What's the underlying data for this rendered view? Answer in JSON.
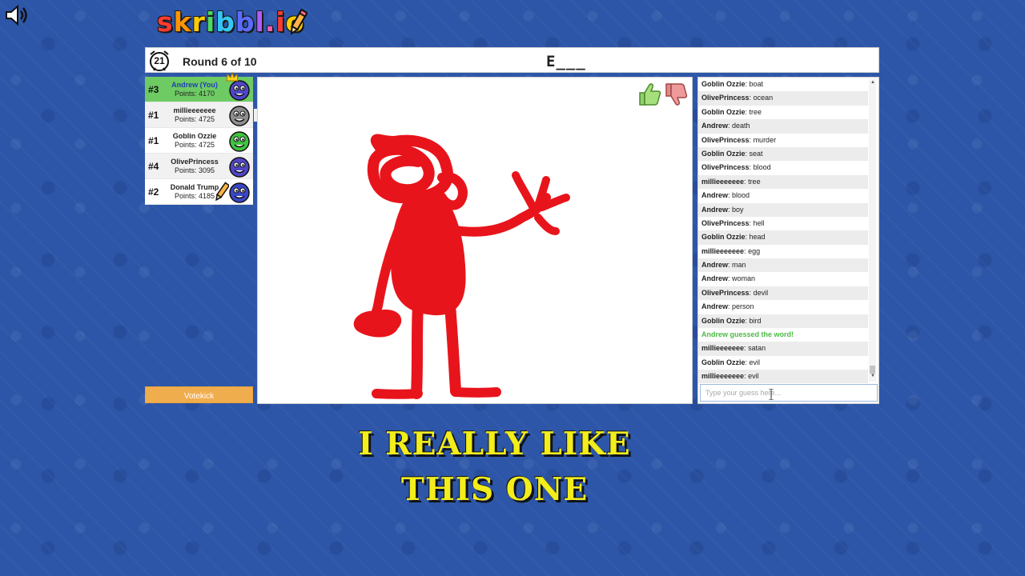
{
  "logo": {
    "letters": [
      "s",
      "k",
      "r",
      "i",
      "b",
      "b",
      "l",
      ".",
      "i",
      "o"
    ],
    "colors": [
      "#ff3b30",
      "#ff9500",
      "#ffcc00",
      "#4cd964",
      "#34c7f2",
      "#5a6cff",
      "#b15cff",
      "#ff5db1",
      "#ff3b30",
      "#ffcc00"
    ]
  },
  "header": {
    "timer": "21",
    "round": "Round 6 of 10",
    "word_hint": "E___"
  },
  "players": [
    {
      "rank": "#3",
      "name": "Andrew (You)",
      "points": "Points: 4170",
      "avatar_color": "#4f46c8",
      "me": true,
      "crown": true,
      "drawing": false
    },
    {
      "rank": "#1",
      "name": "millieeeeeee",
      "points": "Points: 4725",
      "avatar_color": "#8e8e8e",
      "me": false,
      "crown": false,
      "drawing": false
    },
    {
      "rank": "#1",
      "name": "Goblin Ozzie",
      "points": "Points: 4725",
      "avatar_color": "#3ec43e",
      "me": false,
      "crown": false,
      "drawing": false
    },
    {
      "rank": "#4",
      "name": "OlivePrincess",
      "points": "Points: 3095",
      "avatar_color": "#4f46c8",
      "me": false,
      "crown": false,
      "drawing": false
    },
    {
      "rank": "#2",
      "name": "Donald Trump",
      "points": "Points: 4185",
      "avatar_color": "#3a46c8",
      "me": false,
      "crown": false,
      "drawing": true
    }
  ],
  "guess_tip": "evil",
  "votekick_label": "Votekick",
  "chat": {
    "messages": [
      {
        "user": "Goblin Ozzie",
        "text": "boat"
      },
      {
        "user": "OlivePrincess",
        "text": "ocean"
      },
      {
        "user": "Goblin Ozzie",
        "text": "tree"
      },
      {
        "user": "Andrew",
        "text": "death"
      },
      {
        "user": "OlivePrincess",
        "text": "murder"
      },
      {
        "user": "Goblin Ozzie",
        "text": "seat"
      },
      {
        "user": "OlivePrincess",
        "text": "blood"
      },
      {
        "user": "millieeeeeee",
        "text": "tree"
      },
      {
        "user": "Andrew",
        "text": "blood"
      },
      {
        "user": "Andrew",
        "text": "boy"
      },
      {
        "user": "OlivePrincess",
        "text": "hell"
      },
      {
        "user": "Goblin Ozzie",
        "text": "head"
      },
      {
        "user": "millieeeeeee",
        "text": "egg"
      },
      {
        "user": "Andrew",
        "text": "man"
      },
      {
        "user": "Andrew",
        "text": "woman"
      },
      {
        "user": "OlivePrincess",
        "text": "devil"
      },
      {
        "user": "Andrew",
        "text": "person"
      },
      {
        "user": "Goblin Ozzie",
        "text": "bird"
      },
      {
        "user": "",
        "text": "Andrew guessed the word!",
        "guessed": true
      },
      {
        "user": "millieeeeeee",
        "text": "satan"
      },
      {
        "user": "Goblin Ozzie",
        "text": "evil"
      },
      {
        "user": "millieeeeeee",
        "text": "evil"
      }
    ],
    "placeholder": "Type your guess here..."
  },
  "caption": {
    "line1": "I REALLY LIKE",
    "line2": "THIS ONE"
  },
  "drawing_color": "#e8141c"
}
